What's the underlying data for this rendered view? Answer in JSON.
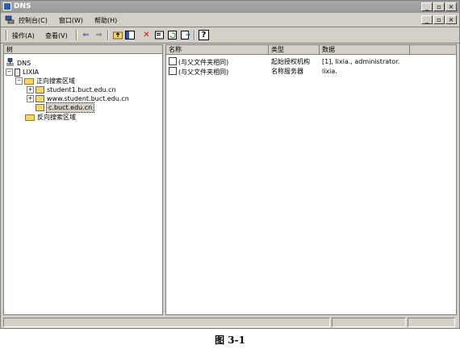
{
  "titlebar": {
    "title": "DNS",
    "minimize": "_",
    "restore": "▫",
    "close": "×"
  },
  "menubar": {
    "items": [
      "控制台(C)",
      "窗口(W)",
      "帮助(H)"
    ],
    "mdi_minimize": "_",
    "mdi_restore": "▫",
    "mdi_close": "×"
  },
  "toolbar": {
    "action": "操作(A)",
    "view": "查看(V)",
    "back": "⇐",
    "forward": "⇒",
    "delete": "✕",
    "help": "?"
  },
  "tree": {
    "header": "树",
    "items": [
      {
        "label": "DNS"
      },
      {
        "label": "LIXIA"
      },
      {
        "label": "正向搜索区域"
      },
      {
        "label": "student1.buct.edu.cn"
      },
      {
        "label": "www.student.buct.edu.cn"
      },
      {
        "label": "c.buct.edu.cn"
      },
      {
        "label": "反向搜索区域"
      }
    ]
  },
  "list": {
    "columns": [
      "名称",
      "类型",
      "数据"
    ],
    "rows": [
      {
        "name": "(与父文件夹相同)",
        "type": "起始授权机构",
        "data": "[1], lixia., administrator."
      },
      {
        "name": "(与父文件夹相同)",
        "type": "名称服务器",
        "data": "lixia."
      }
    ]
  },
  "caption": "图 3-1",
  "colors": {
    "window_face": "#d4d0c8",
    "titlebar_gray": "#9a9a9a"
  }
}
